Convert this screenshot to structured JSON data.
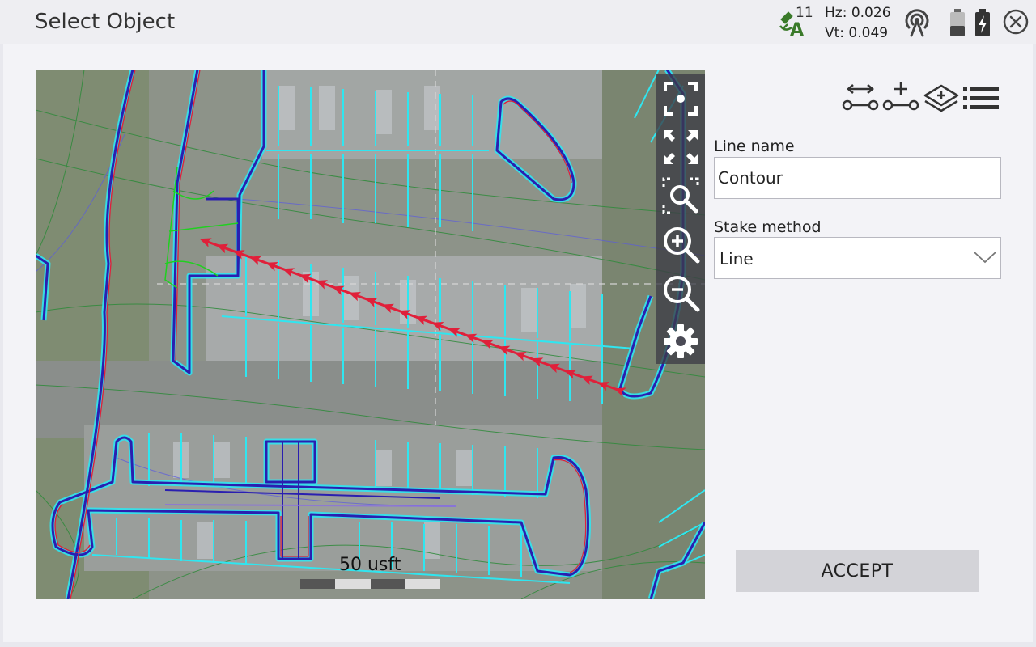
{
  "title": "Select Object",
  "status": {
    "satellites": "11",
    "hz": "Hz: 0.026",
    "vt": "Vt: 0.049",
    "icons": [
      "satellite-icon",
      "radio-icon",
      "battery-icon",
      "battery-charging-icon",
      "close-icon"
    ]
  },
  "map": {
    "scale_label": "50 usft",
    "tools": [
      "zoom-extents-icon",
      "pan-extents-icon",
      "zoom-window-icon",
      "zoom-in-icon",
      "zoom-out-icon",
      "settings-icon"
    ],
    "colors": {
      "aerial": "#8c9286",
      "cyan": "#2fe6f0",
      "outline_blue": "#2a1fb0",
      "outline_red": "#e0203a",
      "contour_green": "#2e8a3a",
      "selected_line": "#e0203a"
    }
  },
  "panel": {
    "tools": [
      "measure-line-icon",
      "add-point-icon",
      "layers-icon",
      "list-icon"
    ],
    "line_name_label": "Line name",
    "line_name_value": "Contour",
    "stake_method_label": "Stake method",
    "stake_method_value": "Line",
    "accept_label": "ACCEPT"
  }
}
